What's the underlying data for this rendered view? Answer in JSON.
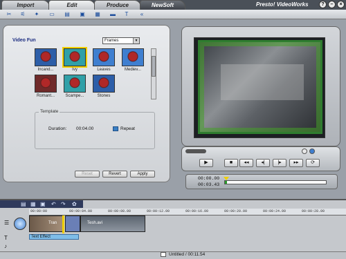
{
  "app": {
    "title": "Presto! VideoWorks",
    "tabs": [
      "Import",
      "Edit",
      "Produce",
      "NewSoft"
    ],
    "active_tab": "Edit",
    "window_buttons": [
      "?",
      "–",
      "×"
    ]
  },
  "video_fun": {
    "title": "Video Fun",
    "dropdown_value": "Frames",
    "thumbnails": [
      {
        "label": "Incand..."
      },
      {
        "label": "Ivy"
      },
      {
        "label": "Leaves"
      },
      {
        "label": "Mediev..."
      },
      {
        "label": "Romant..."
      },
      {
        "label": "Scampe..."
      },
      {
        "label": "Stones"
      }
    ]
  },
  "template": {
    "title": "Template",
    "duration_label": "Duration:",
    "duration_value": "00:04.00",
    "repeat_label": "Repeat"
  },
  "buttons": {
    "reset": "Reset",
    "revert": "Revert",
    "apply": "Apply"
  },
  "player": {
    "current_time": "00:00.00",
    "total_time": "00:03.43",
    "progress": 0.02
  },
  "timeline": {
    "ruler_marks": [
      "00:00:00",
      "00:00:04.00",
      "00:00:08.00",
      "00:00:12.00",
      "00:00:16.00",
      "00:00:20.00",
      "00:00:24.00",
      "00:00:28.00"
    ],
    "clip1_label": "Tran",
    "clip2_label": "Tesh.avi",
    "text_track_label": "Text Effect"
  },
  "status": {
    "text": "Untitled / 00:11.54"
  }
}
